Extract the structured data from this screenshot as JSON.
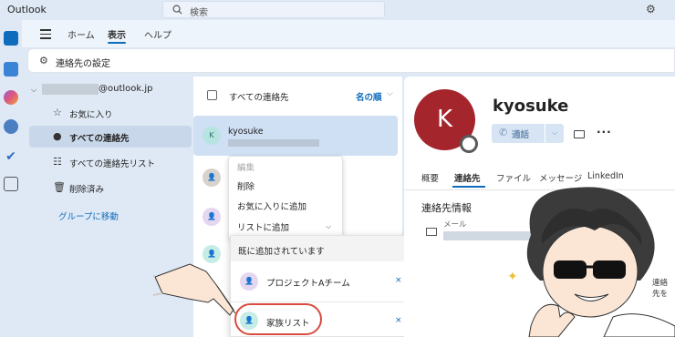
{
  "app_title": "Outlook",
  "search": {
    "placeholder": "検索"
  },
  "menu": {
    "tabs": [
      "ホーム",
      "表示",
      "ヘルプ"
    ],
    "active": "表示"
  },
  "ribbon": {
    "contact_settings": "連絡先の設定"
  },
  "nav": {
    "account": "@outlook.jp",
    "items": [
      {
        "label": "お気に入り",
        "icon": "star-icon"
      },
      {
        "label": "すべての連絡先",
        "icon": "person-icon",
        "selected": true
      },
      {
        "label": "すべての連絡先リスト",
        "icon": "people-list-icon"
      },
      {
        "label": "削除済み",
        "icon": "trash-icon"
      }
    ],
    "move_group": "グループに移動"
  },
  "list": {
    "header": "すべての連絡先",
    "sort": "名の順",
    "selected_contact": {
      "initial": "K",
      "name": "kyosuke"
    }
  },
  "context_menu": {
    "items": [
      "編集",
      "削除",
      "お気に入りに追加",
      "リストに追加"
    ]
  },
  "submenu": {
    "header": "既に追加されています",
    "items": [
      {
        "label": "プロジェクトAチーム",
        "remove": "×"
      },
      {
        "label": "家族リスト",
        "remove": "×"
      }
    ]
  },
  "detail": {
    "initial": "K",
    "name": "kyosuke",
    "call": "通話",
    "more": "···",
    "tabs": [
      "概要",
      "連絡先",
      "ファイル",
      "メッセージ",
      "LinkedIn"
    ],
    "active_tab": "連絡先",
    "contact_info_title": "連絡先情報",
    "email_label": "メール",
    "right_label": "連絡先を"
  },
  "colors": {
    "accent": "#0f6cbd",
    "avatar_bg": "#a4262c",
    "highlight": "#d94b3f"
  }
}
